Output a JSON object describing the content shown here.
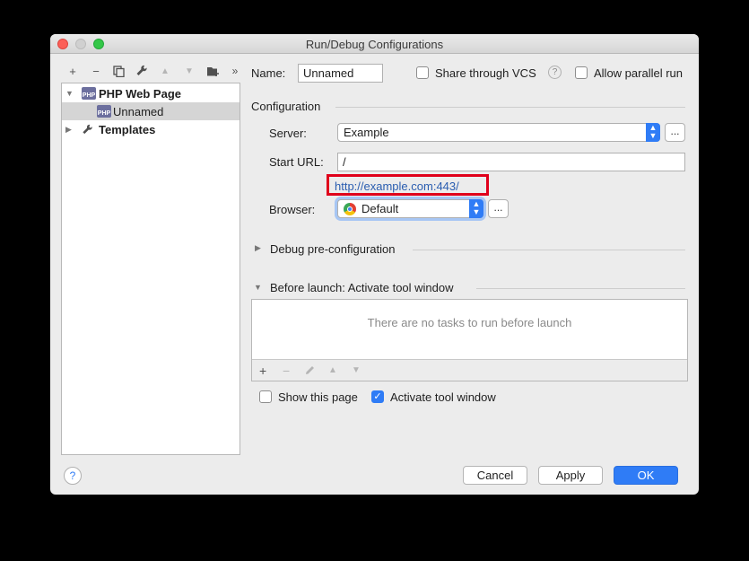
{
  "window": {
    "title": "Run/Debug Configurations"
  },
  "toolbar": {
    "add": "+",
    "remove": "−",
    "copy": "⧉",
    "edit": "🔧",
    "up": "▲",
    "down": "▼",
    "folder": "▰",
    "more": "»"
  },
  "tree": {
    "group_label": "PHP Web Page",
    "group_icon_text": "PHP",
    "item_label": "Unnamed",
    "templates_label": "Templates"
  },
  "form": {
    "name_label": "Name:",
    "name_value": "Unnamed",
    "share_vcs_label": "Share through VCS",
    "allow_parallel_label": "Allow parallel run",
    "configuration_header": "Configuration",
    "server_label": "Server:",
    "server_value": "Example",
    "start_url_label": "Start URL:",
    "start_url_value": "/",
    "resolved_url": "http://example.com:443/",
    "browser_label": "Browser:",
    "browser_value": "Default",
    "dots": "...",
    "debug_preconfig_label": "Debug pre-configuration",
    "before_launch_label": "Before launch: Activate tool window",
    "no_tasks_text": "There are no tasks to run before launch",
    "show_page_label": "Show this page",
    "activate_tool_window_label": "Activate tool window"
  },
  "buttons": {
    "help": "?",
    "cancel": "Cancel",
    "apply": "Apply",
    "ok": "OK"
  },
  "colors": {
    "accent": "#2f7cf6",
    "highlight_box": "#e0001b",
    "link": "#2a5db0"
  }
}
